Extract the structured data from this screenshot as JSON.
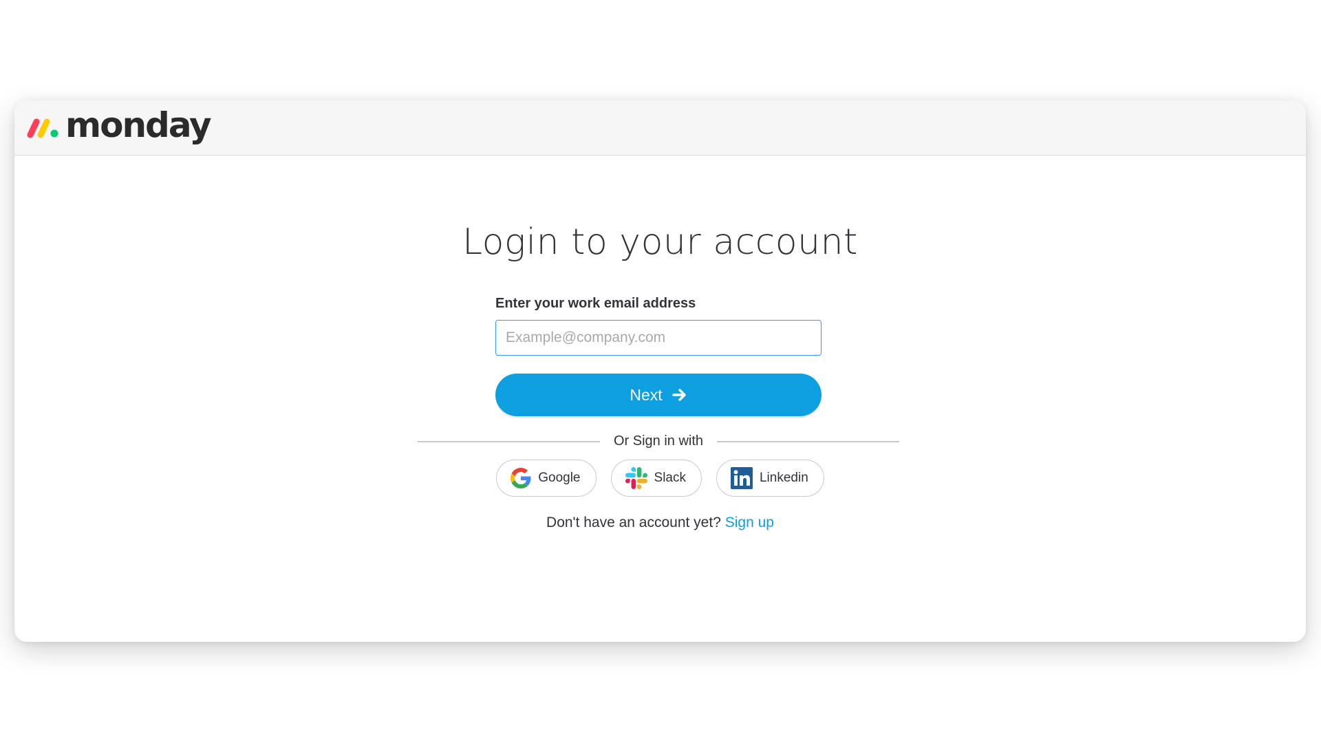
{
  "brand": {
    "name": "monday",
    "colors": [
      "#ff3d57",
      "#ffcb00",
      "#00ca72"
    ]
  },
  "login": {
    "title": "Login to your account",
    "email_label": "Enter your work email address",
    "email_placeholder": "Example@company.com",
    "email_value": "",
    "next_label": "Next",
    "next_icon": "arrow-right-icon",
    "accent_color": "#0d9fe0"
  },
  "divider": {
    "text": "Or Sign in with"
  },
  "social": [
    {
      "label": "Google",
      "icon": "google-icon"
    },
    {
      "label": "Slack",
      "icon": "slack-icon"
    },
    {
      "label": "Linkedin",
      "icon": "linkedin-icon"
    }
  ],
  "signup": {
    "prompt": "Don't have an account yet?",
    "link": "Sign up"
  }
}
